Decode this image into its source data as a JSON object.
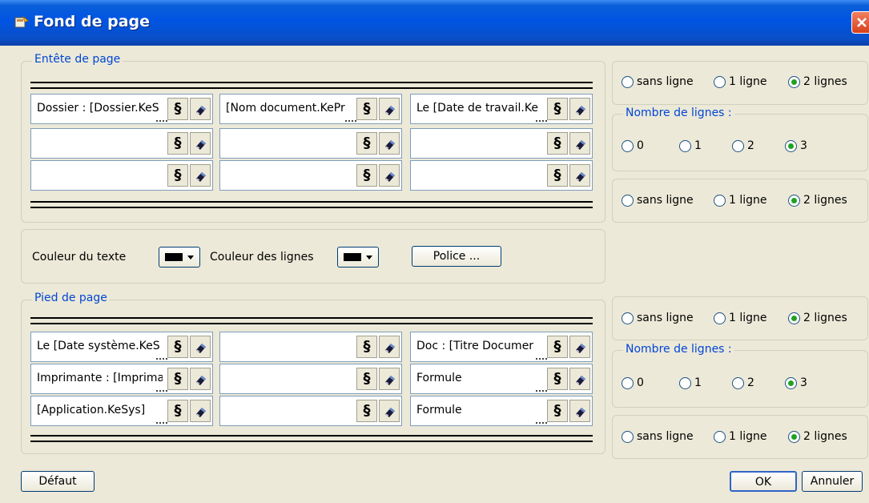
{
  "window": {
    "title": "Fond de page",
    "close_icon": "close-icon"
  },
  "header": {
    "legend": "Entête de page",
    "cells": [
      [
        "Dossier : [Dossier.KeS",
        "[Nom document.KePr",
        "Le [Date de travail.Ke"
      ],
      [
        "",
        "",
        ""
      ],
      [
        "",
        "",
        ""
      ]
    ],
    "top_line_options": [
      "sans ligne",
      "1 ligne",
      "2 lignes"
    ],
    "top_line_selected": "2 lignes",
    "nb_lines_legend": "Nombre de lignes :",
    "nb_lines_options": [
      "0",
      "1",
      "2",
      "3"
    ],
    "nb_lines_selected": "3",
    "bottom_line_options": [
      "sans ligne",
      "1 ligne",
      "2 lignes"
    ],
    "bottom_line_selected": "2 lignes"
  },
  "colors": {
    "text_color_label": "Couleur du texte",
    "text_color": "#000000",
    "line_color_label": "Couleur des lignes",
    "line_color": "#000000",
    "font_button": "Police ..."
  },
  "footer": {
    "legend": "Pied de page",
    "cells": [
      [
        "Le [Date système.KeS",
        "",
        "Doc : [Titre Documer"
      ],
      [
        "Imprimante : [Imprimar",
        "",
        "Formule"
      ],
      [
        "[Application.KeSys]",
        "",
        "Formule"
      ]
    ],
    "top_line_options": [
      "sans ligne",
      "1 ligne",
      "2 lignes"
    ],
    "top_line_selected": "2 lignes",
    "nb_lines_legend": "Nombre de lignes :",
    "nb_lines_options": [
      "0",
      "1",
      "2",
      "3"
    ],
    "nb_lines_selected": "3",
    "bottom_line_options": [
      "sans ligne",
      "1 ligne",
      "2 lignes"
    ],
    "bottom_line_selected": "2 lignes"
  },
  "buttons": {
    "default": "Défaut",
    "ok": "OK",
    "cancel": "Annuler"
  },
  "icons": {
    "section": "§",
    "eraser": "eraser-icon",
    "app": "page-background-icon"
  }
}
